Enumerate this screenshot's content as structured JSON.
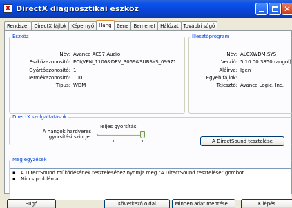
{
  "window": {
    "title": "DirectX diagnosztikai eszköz"
  },
  "tabs": [
    "Rendszer",
    "DirectX fájlok",
    "Képernyő",
    "Hang",
    "Zene",
    "Bemenet",
    "Hálózat",
    "További súgó"
  ],
  "active_tab": "Hang",
  "device": {
    "legend": "Eszköz",
    "rows": [
      {
        "label": "Név:",
        "value": "Avance AC97 Audio"
      },
      {
        "label": "Eszközazonosító:",
        "value": "PCI\\VEN_1106&DEV_3059&SUBSYS_09971"
      },
      {
        "label": "Gyártóazonosító:",
        "value": "1"
      },
      {
        "label": "Termékazonosító:",
        "value": "100"
      },
      {
        "label": "Típus:",
        "value": "WDM"
      }
    ]
  },
  "driver": {
    "legend": "Illesztőprogram",
    "rows": [
      {
        "label": "Név:",
        "value": "ALCXWDM.SYS"
      },
      {
        "label": "Verzió:",
        "value": "5.10.00.3850 (angol)"
      },
      {
        "label": "Aláírva:",
        "value": "Igen"
      },
      {
        "label": "Egyéb fájlok:",
        "value": ""
      },
      {
        "label": "Tejesztő:",
        "value": "Avance Logic, Inc."
      }
    ]
  },
  "directsound": {
    "legend": "DirectX szolgáltatások",
    "accel_label_line1": "A hangok hardveres",
    "accel_label_line2": "gyorsítási szintje:",
    "accel_level_text": "Teljes gyorsítás",
    "accel_level": 3,
    "accel_max": 3,
    "test_button": "A DirectSound tesztelése"
  },
  "notes": {
    "legend": "Megjegyzések",
    "items": [
      "A DirectSound működésének teszteléséhez nyomja meg \"A DirectSound tesztelése\" gombot.",
      "Nincs probléma."
    ]
  },
  "buttons": {
    "help": "Súgó",
    "next_page": "Következő oldal",
    "save_all": "Minden adat mentése...",
    "exit": "Kilépés"
  }
}
